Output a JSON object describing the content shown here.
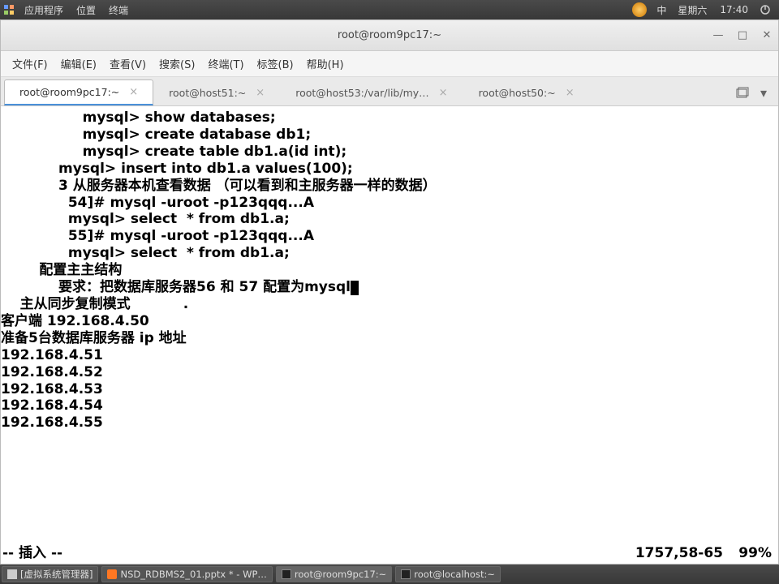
{
  "top_panel": {
    "apps": "应用程序",
    "places": "位置",
    "terminal_menu": "终端",
    "ime": "中",
    "day": "星期六",
    "time": "17:40"
  },
  "window": {
    "title": "root@room9pc17:~"
  },
  "menubar": {
    "file": "文件(F)",
    "edit": "编辑(E)",
    "view": "查看(V)",
    "search": "搜索(S)",
    "terminal": "终端(T)",
    "tabs": "标签(B)",
    "help": "帮助(H)"
  },
  "tabs": [
    {
      "label": "root@room9pc17:~",
      "active": true
    },
    {
      "label": "root@host51:~",
      "active": false
    },
    {
      "label": "root@host53:/var/lib/my…",
      "active": false
    },
    {
      "label": "root@host50:~",
      "active": false
    }
  ],
  "terminal": {
    "lines": [
      "                 mysql> show databases;",
      "                 mysql> create database db1;",
      "                 mysql> create table db1.a(id int);",
      "            mysql> insert into db1.a values(100);",
      "",
      "            3 从服务器本机查看数据 （可以看到和主服务器一样的数据）",
      "              54]# mysql -uroot -p123qqq...A",
      "              mysql> select  * from db1.a;",
      "",
      "              55]# mysql -uroot -p123qqq...A",
      "              mysql> select  * from db1.a;",
      "",
      "        配置主主结构",
      "            要求：把数据库服务器56 和 57 配置为mysql",
      "",
      "",
      "",
      "    主从同步复制模式           .",
      "",
      "客户端 192.168.4.50",
      "准备5台数据库服务器 ip 地址",
      "192.168.4.51",
      "192.168.4.52",
      "192.168.4.53",
      "192.168.4.54",
      "192.168.4.55"
    ],
    "cursor_line_index": 13,
    "status_mode": "-- 插入 --",
    "status_pos": "1757,58-65",
    "status_pct": "99%"
  },
  "taskbar": {
    "items": [
      {
        "label": "[虚拟系统管理器]",
        "icon": "vm"
      },
      {
        "label": "NSD_RDBMS2_01.pptx * - WP…",
        "icon": "orange"
      },
      {
        "label": "root@room9pc17:~",
        "icon": "term"
      },
      {
        "label": "root@localhost:~",
        "icon": "term"
      }
    ]
  }
}
